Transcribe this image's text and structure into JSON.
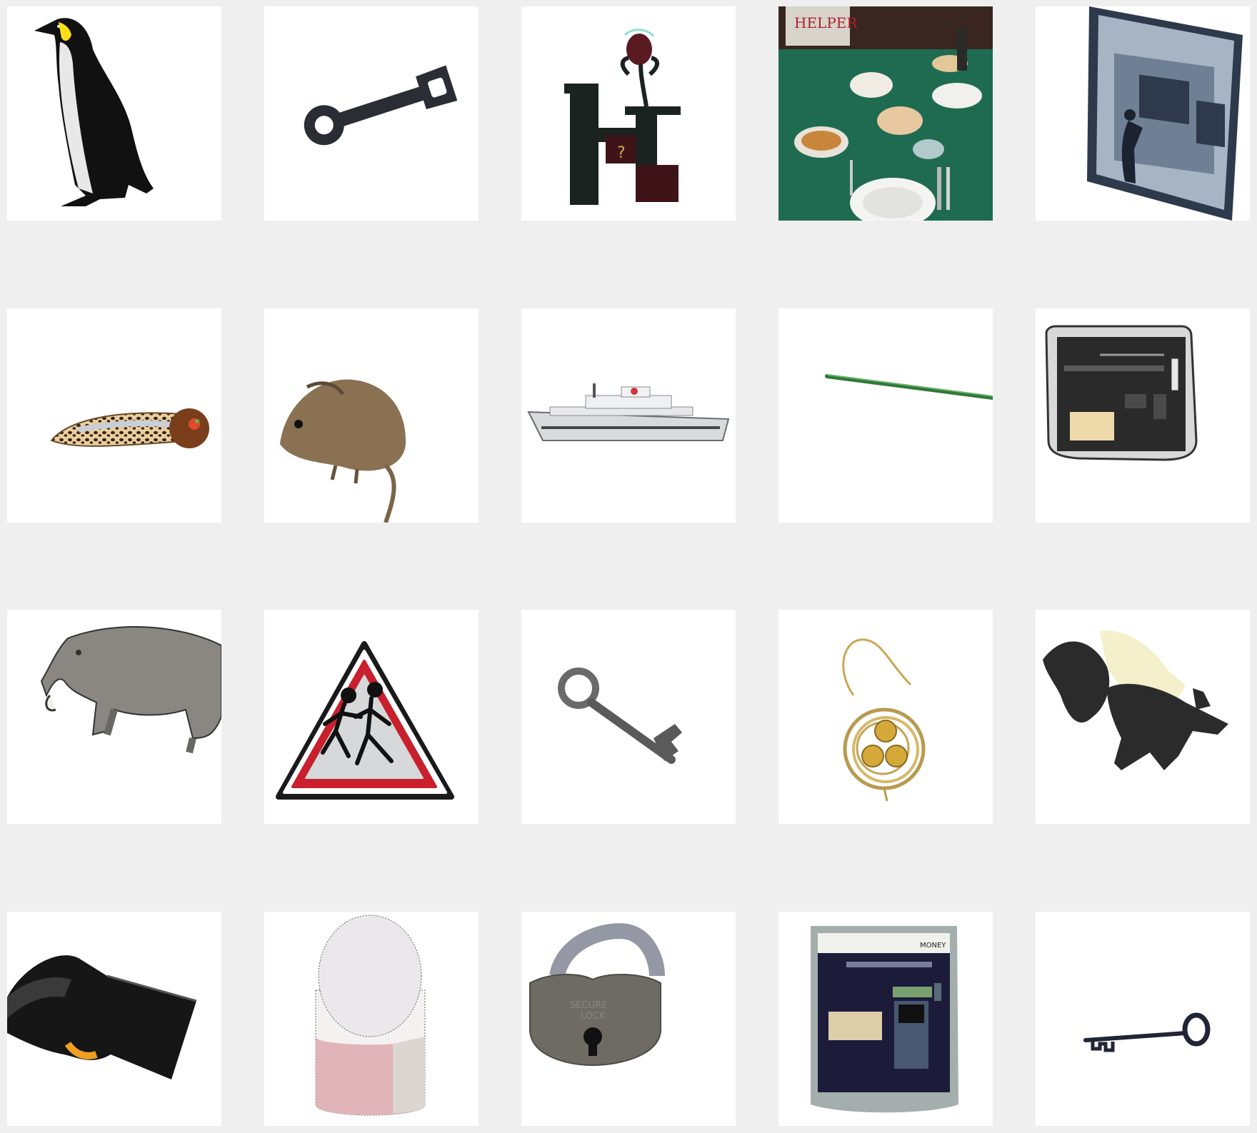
{
  "grid": {
    "rows": 4,
    "columns": 5,
    "tiles": [
      {
        "icon": "penguin-icon"
      },
      {
        "icon": "wrench-key-icon"
      },
      {
        "icon": "letter-h-flower-icon"
      },
      {
        "icon": "dinner-table-photo",
        "banner_text": "HELPER"
      },
      {
        "icon": "atm-framed-picture-icon"
      },
      {
        "icon": "leopard-hair-clip-icon"
      },
      {
        "icon": "mouse-icon"
      },
      {
        "icon": "ship-icon"
      },
      {
        "icon": "green-stick-icon"
      },
      {
        "icon": "atm-machine-icon"
      },
      {
        "icon": "warthog-icon"
      },
      {
        "icon": "children-crossing-sign-icon"
      },
      {
        "icon": "old-key-icon"
      },
      {
        "icon": "nest-earring-icon"
      },
      {
        "icon": "skunk-icon"
      },
      {
        "icon": "barcode-scanner-icon"
      },
      {
        "icon": "cylinder-container-icon"
      },
      {
        "icon": "padlock-icon",
        "lock_text_line1": "SECURE",
        "lock_text_line2": "LOCK"
      },
      {
        "icon": "atm-money-icon",
        "atm_label": "MONEY"
      },
      {
        "icon": "skeleton-key-icon"
      }
    ]
  },
  "colors": {
    "background": "#efefef",
    "tile": "#ffffff",
    "table_green": "#1f6b52",
    "sign_red": "#c8202c",
    "atm_navy": "#1c1c3a"
  }
}
